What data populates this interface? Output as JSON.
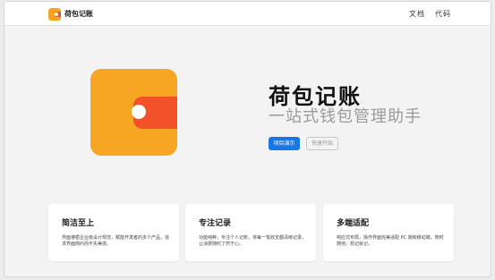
{
  "navbar": {
    "brand_name": "荷包记账",
    "links": [
      {
        "label": "文档"
      },
      {
        "label": "代码"
      }
    ]
  },
  "hero": {
    "logo_icon": "wallet-icon",
    "title": "荷包记账",
    "subtitle": "一站式钱包管理助手",
    "buttons": {
      "primary_label": "项目演示",
      "secondary_label": "快速开始"
    }
  },
  "features": [
    {
      "title": "简洁至上",
      "description": "界面遵循企业级设计规范，赋能开发者的多个产品，追求界面简约而不失美感。"
    },
    {
      "title": "专注记录",
      "description": "功能纯粹，专注个人记账，将每一笔收支都清晰记录，让消费随时了然于心。"
    },
    {
      "title": "多端适配",
      "description": "响应式布局，操作界面完美适配 PC 端和移动端，随时随地，想记就记。"
    }
  ],
  "colors": {
    "brand_orange": "#f6a623",
    "brand_red": "#f2512a",
    "primary_blue": "#1677e8"
  }
}
